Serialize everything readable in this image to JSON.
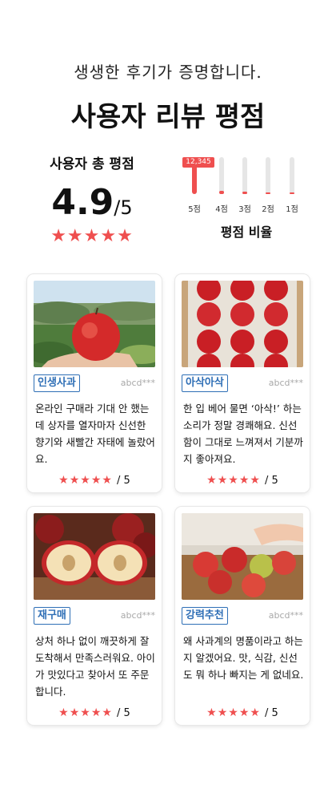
{
  "header": {
    "subtitle": "생생한 후기가 증명합니다.",
    "title": "사용자 리뷰 평점"
  },
  "summary": {
    "label": "사용자 총 평점",
    "score": "4.9",
    "max": "/5",
    "stars": "★★★★★"
  },
  "distribution": {
    "title": "평점 비율",
    "top_count": "12,345",
    "bars": [
      {
        "label": "5점",
        "fraction": 1.0
      },
      {
        "label": "4점",
        "fraction": 0.08
      },
      {
        "label": "3점",
        "fraction": 0.06
      },
      {
        "label": "2점",
        "fraction": 0.05
      },
      {
        "label": "1점",
        "fraction": 0.04
      }
    ]
  },
  "reviews": [
    {
      "tag": "인생사과",
      "author": "abcd***",
      "text": "온라인 구매라 기대 안 했는데 상자를 열자마자 신선한 향기와 새빨간 자태에 놀랐어요.",
      "stars": "★★★★★",
      "max": "/ 5"
    },
    {
      "tag": "아삭아삭",
      "author": "abcd***",
      "text": "한 입 베어 물면 ‘아삭!’ 하는 소리가 정말 경쾌해요. 신선함이 그대로 느껴져서 기분까지 좋아져요.",
      "stars": "★★★★★",
      "max": "/ 5"
    },
    {
      "tag": "재구매",
      "author": "abcd***",
      "text": "상처 하나 없이 깨끗하게 잘 도착해서 만족스러워요. 아이가 맛있다고 찾아서 또 주문합니다.",
      "stars": "★★★★★",
      "max": "/ 5"
    },
    {
      "tag": "강력추천",
      "author": "abcd***",
      "text": "왜 사과계의 명품이라고 하는지 알겠어요. 맛, 식감, 신선도 뭐 하나 빠지는 게 없네요.",
      "stars": "★★★★★",
      "max": "/ 5"
    }
  ],
  "colors": {
    "accent": "#ef4f4f",
    "tag": "#2f6fb6"
  }
}
